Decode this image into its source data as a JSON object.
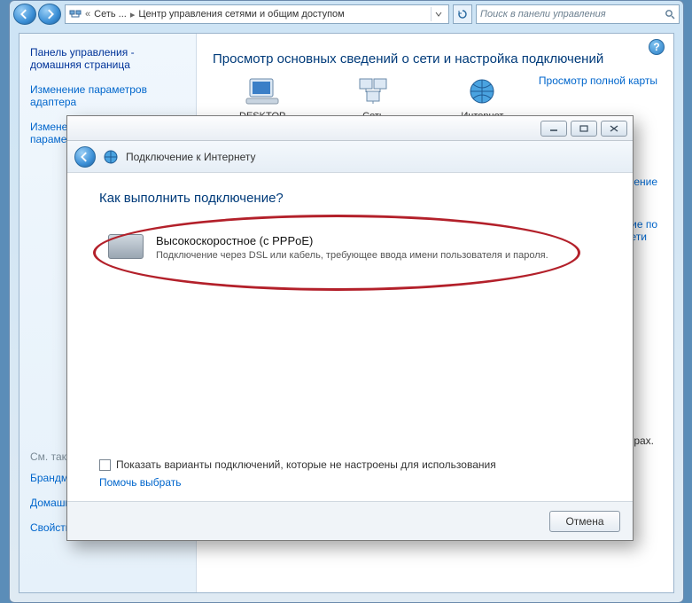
{
  "titlebar": {
    "crumb1": "Сеть ...",
    "crumb2": "Центр управления сетями и общим доступом",
    "search_placeholder": "Поиск в панели управления"
  },
  "sidebar": {
    "home_title": "Панель управления - домашняя страница",
    "link_adapter": "Изменение параметров адаптера",
    "link_sharing_prefix": "Измене",
    "link_sharing_suffix": "параме",
    "see_also": "См. также",
    "firewall": "Брандмауэр Windows",
    "homegroup": "Домашняя группа",
    "inet_options": "Свойства обозревателя"
  },
  "main": {
    "heading": "Просмотр основных сведений о сети и настройка подключений",
    "map_link": "Просмотр полной карты",
    "icon_desktop": "DESKTOP",
    "icon_network": "Сеть",
    "icon_internet": "Интернет",
    "right_link1": "ключение",
    "right_link2_line1": "ние по",
    "right_link2_line2": "сети",
    "right_text1": "терах."
  },
  "wizard": {
    "header_title": "Подключение к Интернету",
    "question": "Как выполнить подключение?",
    "option": {
      "title": "Высокоскоростное (с PPPoE)",
      "desc": "Подключение через DSL или кабель, требующее ввода имени пользователя и пароля."
    },
    "show_unconfigured_label": "Показать варианты подключений, которые не настроены для использования",
    "help_choose": "Помочь выбрать",
    "cancel": "Отмена"
  }
}
